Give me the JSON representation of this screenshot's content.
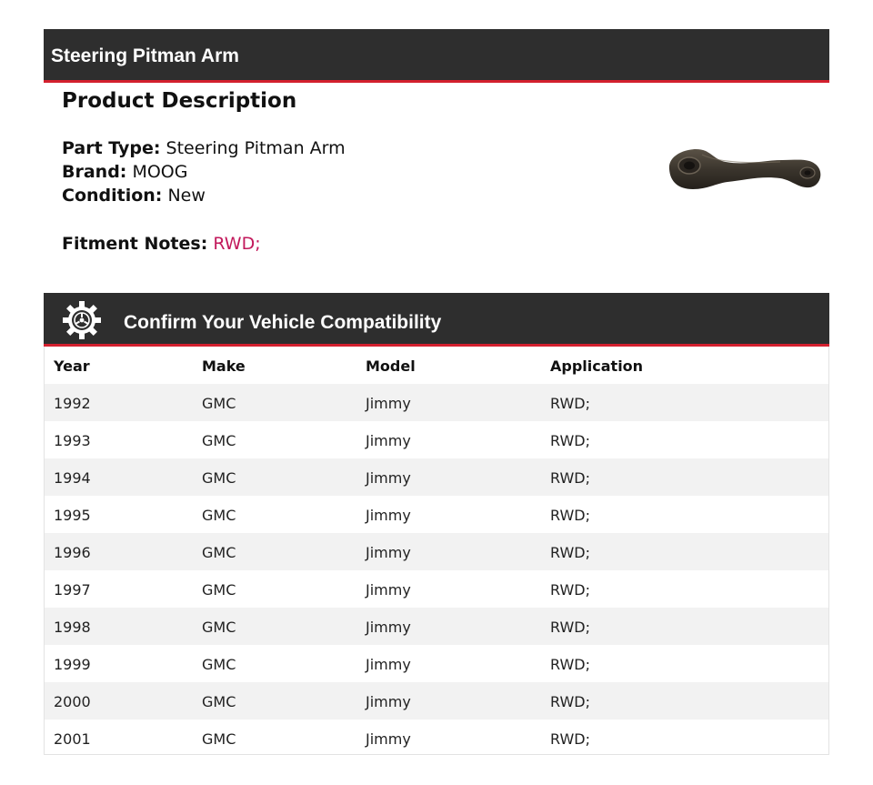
{
  "header": {
    "title": "Steering Pitman Arm"
  },
  "description": {
    "title": "Product Description",
    "part_type_label": "Part Type:",
    "part_type_value": "Steering Pitman Arm",
    "brand_label": "Brand:",
    "brand_value": "MOOG",
    "condition_label": "Condition:",
    "condition_value": "New",
    "fitment_label": "Fitment Notes:",
    "fitment_value": "RWD;",
    "accent_color": "#c2185b"
  },
  "compatibility": {
    "title": "Confirm Your Vehicle Compatibility",
    "icon": "gear-car-icon",
    "columns": [
      "Year",
      "Make",
      "Model",
      "Application"
    ],
    "rows": [
      [
        "1992",
        "GMC",
        "Jimmy",
        "RWD;"
      ],
      [
        "1993",
        "GMC",
        "Jimmy",
        "RWD;"
      ],
      [
        "1994",
        "GMC",
        "Jimmy",
        "RWD;"
      ],
      [
        "1995",
        "GMC",
        "Jimmy",
        "RWD;"
      ],
      [
        "1996",
        "GMC",
        "Jimmy",
        "RWD;"
      ],
      [
        "1997",
        "GMC",
        "Jimmy",
        "RWD;"
      ],
      [
        "1998",
        "GMC",
        "Jimmy",
        "RWD;"
      ],
      [
        "1999",
        "GMC",
        "Jimmy",
        "RWD;"
      ],
      [
        "2000",
        "GMC",
        "Jimmy",
        "RWD;"
      ],
      [
        "2001",
        "GMC",
        "Jimmy",
        "RWD;"
      ]
    ]
  },
  "colors": {
    "bar_bg": "#2e2e2e",
    "bar_accent": "#d3202e",
    "row_alt": "#f2f2f2"
  }
}
